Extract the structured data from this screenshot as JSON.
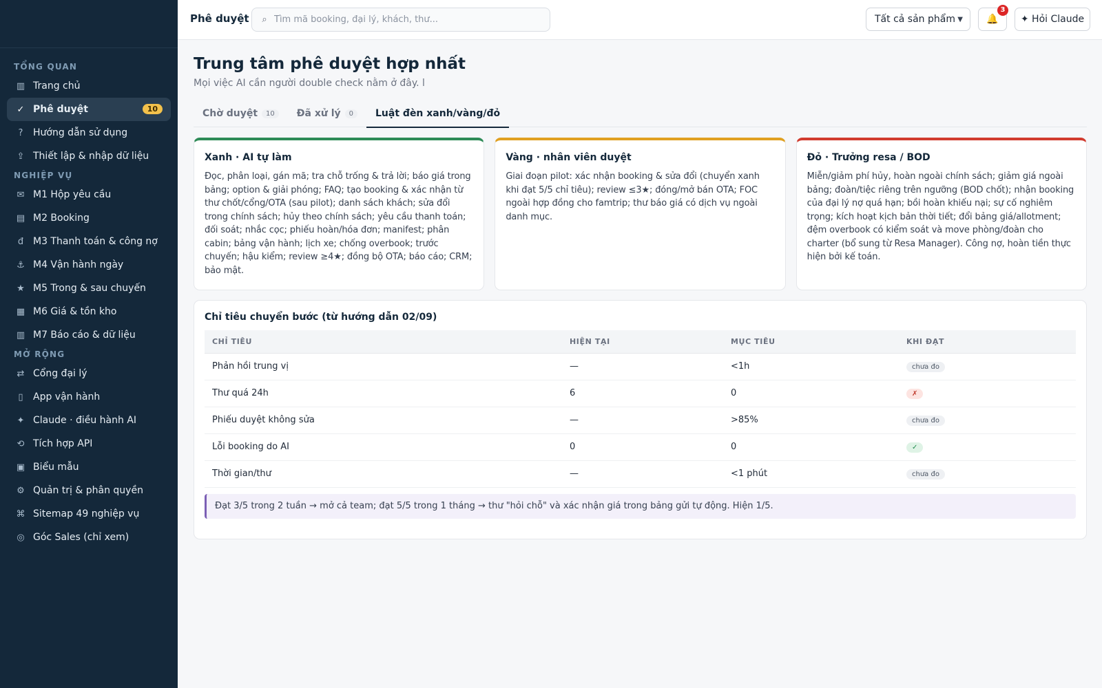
{
  "sidebar": {
    "sections": [
      {
        "title": "TỔNG QUAN",
        "items": [
          {
            "icon": "▥",
            "label": "Trang chủ"
          },
          {
            "icon": "✓",
            "label": "Phê duyệt",
            "badge": "10",
            "active": true
          },
          {
            "icon": "?",
            "label": "Hướng dẫn sử dụng"
          },
          {
            "icon": "⇪",
            "label": "Thiết lập & nhập dữ liệu"
          }
        ]
      },
      {
        "title": "NGHIỆP VỤ",
        "items": [
          {
            "icon": "✉",
            "label": "M1 Hộp yêu cầu"
          },
          {
            "icon": "▤",
            "label": "M2 Booking"
          },
          {
            "icon": "đ",
            "label": "M3 Thanh toán & công nợ"
          },
          {
            "icon": "⚓",
            "label": "M4 Vận hành ngày"
          },
          {
            "icon": "★",
            "label": "M5 Trong & sau chuyến"
          },
          {
            "icon": "▦",
            "label": "M6 Giá & tồn kho"
          },
          {
            "icon": "▥",
            "label": "M7 Báo cáo & dữ liệu"
          }
        ]
      },
      {
        "title": "MỞ RỘNG",
        "items": [
          {
            "icon": "⇄",
            "label": "Cổng đại lý"
          },
          {
            "icon": "▯",
            "label": "App vận hành"
          },
          {
            "icon": "✦",
            "label": "Claude · điều hành AI"
          },
          {
            "icon": "⟲",
            "label": "Tích hợp API"
          },
          {
            "icon": "▣",
            "label": "Biểu mẫu"
          },
          {
            "icon": "⚙",
            "label": "Quản trị & phân quyền"
          },
          {
            "icon": "⌘",
            "label": "Sitemap 49 nghiệp vụ"
          },
          {
            "icon": "◎",
            "label": "Góc Sales (chỉ xem)"
          }
        ]
      }
    ]
  },
  "topbar": {
    "title": "Phê duyệt",
    "search_placeholder": "Tìm mã booking, đại lý, khách, thư...",
    "search_icon": "⌕",
    "product_select": "Tất cả sản phẩm",
    "notifications": "3",
    "ask_label": "✦ Hỏi Claude"
  },
  "page": {
    "title": "Trung tâm phê duyệt hợp nhất",
    "subtitle": "Mọi việc AI cần người double check nằm ở đây. l"
  },
  "tabs": [
    {
      "label": "Chờ duyệt",
      "count": "10"
    },
    {
      "label": "Đã xử lý",
      "count": "0"
    },
    {
      "label": "Luật đèn xanh/vàng/đỏ",
      "active": true
    }
  ],
  "cards": [
    {
      "title": "Xanh · AI tự làm",
      "body": "Đọc, phân loại, gán mã; tra chỗ trống & trả lời; báo giá trong bảng; option & giải phóng; FAQ; tạo booking & xác nhận từ thư chốt/cổng/OTA (sau pilot); danh sách khách; sửa đổi trong chính sách; hủy theo chính sách; yêu cầu thanh toán; đối soát; nhắc cọc; phiếu hoàn/hóa đơn; manifest; phân cabin; bảng vận hành; lịch xe; chống overbook; trước chuyến; hậu kiểm; review ≥4★; đồng bộ OTA; báo cáo; CRM; bảo mật."
    },
    {
      "title": "Vàng · nhân viên duyệt",
      "body": "Giai đoạn pilot: xác nhận booking & sửa đổi (chuyển xanh khi đạt 5/5 chỉ tiêu); review ≤3★; đóng/mở bán OTA; FOC ngoài hợp đồng cho famtrip; thư báo giá có dịch vụ ngoài danh mục."
    },
    {
      "title": "Đỏ · Trưởng resa / BOD",
      "body": "Miễn/giảm phí hủy, hoàn ngoài chính sách; giảm giá ngoài bảng; đoàn/tiệc riêng trên ngưỡng (BOD chốt); nhận booking của đại lý nợ quá hạn; bồi hoàn khiếu nại; sự cố nghiêm trọng; kích hoạt kịch bản thời tiết; đổi bảng giá/allotment; đệm overbook có kiểm soát và move phòng/đoàn cho charter (bổ sung từ Resa Manager). Công nợ, hoàn tiền thực hiện bởi kế toán."
    }
  ],
  "targets": {
    "title": "Chỉ tiêu chuyển bước (từ hướng dẫn 02/09)",
    "headers": [
      "CHỈ TIÊU",
      "HIỆN TẠI",
      "MỤC TIÊU",
      "KHI ĐẠT"
    ],
    "rows": [
      {
        "name": "Phản hồi trung vị",
        "current": "—",
        "target": "<1h",
        "status": "chưa đo"
      },
      {
        "name": "Thư quá 24h",
        "current": "6",
        "target": "0",
        "status": "✗"
      },
      {
        "name": "Phiếu duyệt không sửa",
        "current": "—",
        "target": ">85%",
        "status": "chưa đo"
      },
      {
        "name": "Lỗi booking do AI",
        "current": "0",
        "target": "0",
        "status": "✓"
      },
      {
        "name": "Thời gian/thư",
        "current": "—",
        "target": "<1 phút",
        "status": "chưa đo"
      }
    ],
    "note": "Đạt 3/5 trong 2 tuần → mở cả team; đạt 5/5 trong 1 tháng → thư \"hỏi chỗ\" và xác nhận giá trong bảng gửi tự động. Hiện 1/5."
  }
}
